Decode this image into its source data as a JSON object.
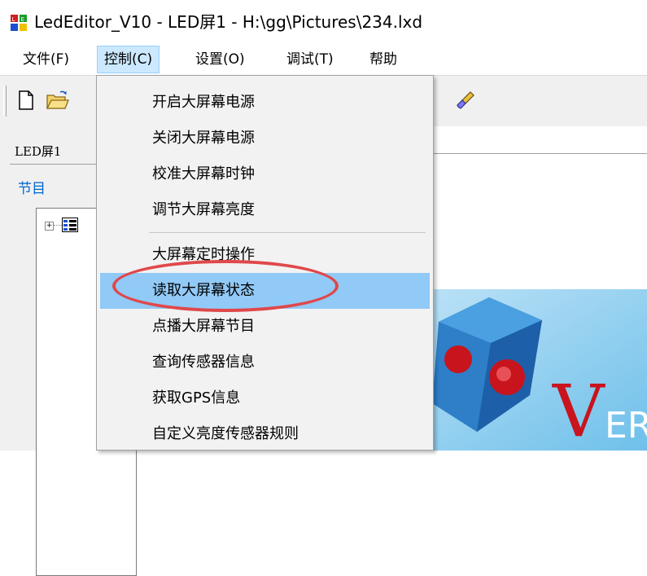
{
  "window": {
    "title": "LedEditor_V10 - LED屏1 - H:\\gg\\Pictures\\234.lxd"
  },
  "menubar": {
    "items": [
      "文件(F)",
      "控制(C)",
      "设置(O)",
      "调试(T)",
      "帮助"
    ]
  },
  "left_panel": {
    "tab_label": "LED屏1",
    "section_label": "节目",
    "tree_expander": "+"
  },
  "control_menu": {
    "items": [
      "开启大屏幕电源",
      "关闭大屏幕电源",
      "校准大屏幕时钟",
      "调节大屏幕亮度",
      "大屏幕定时操作",
      "读取大屏幕状态",
      "点播大屏幕节目",
      "查询传感器信息",
      "获取GPS信息",
      "自定义亮度传感器规则"
    ],
    "highlighted": "读取大屏幕状态"
  },
  "logo": {
    "letters": "VER"
  },
  "colors": {
    "menu_active_bg": "#cce8ff",
    "dropdown_highlight": "#91c9f7",
    "annotation_ellipse": "#e0484a",
    "section_label": "#0066cc"
  },
  "icons": [
    "app-icon",
    "new-file-icon",
    "open-folder-icon",
    "brush-icon",
    "tree-node-icon"
  ]
}
